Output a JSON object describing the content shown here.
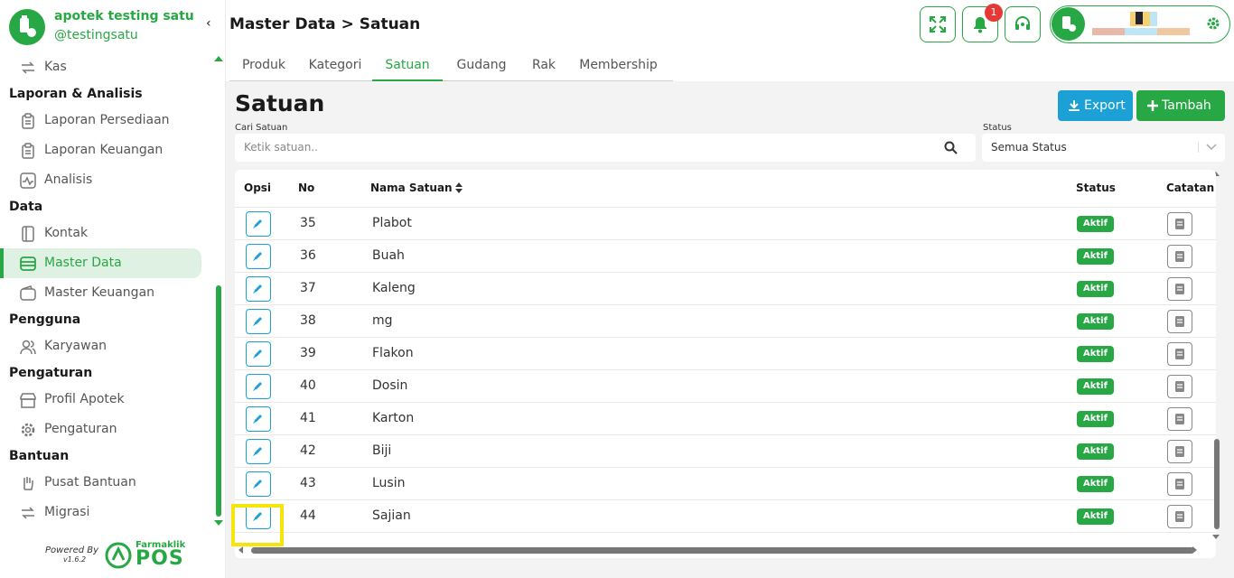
{
  "brand": {
    "name": "apotek testing satu",
    "handle": "@testingsatu",
    "color": "#27a844"
  },
  "sidebar": {
    "collapse_icon": "chevron-left-icon",
    "groups": [
      {
        "items": [
          {
            "label": "Kas",
            "icon": "cash-transfer-icon"
          }
        ]
      },
      {
        "title": "Laporan & Analisis",
        "items": [
          {
            "label": "Laporan Persediaan",
            "icon": "clipboard-icon"
          },
          {
            "label": "Laporan Keuangan",
            "icon": "clipboard-icon"
          },
          {
            "label": "Analisis",
            "icon": "activity-icon"
          }
        ]
      },
      {
        "title": "Data",
        "items": [
          {
            "label": "Kontak",
            "icon": "contact-book-icon"
          },
          {
            "label": "Master Data",
            "icon": "database-icon",
            "active": true
          },
          {
            "label": "Master Keuangan",
            "icon": "wallet-icon"
          }
        ]
      },
      {
        "title": "Pengguna",
        "items": [
          {
            "label": "Karyawan",
            "icon": "users-icon"
          }
        ]
      },
      {
        "title": "Pengaturan",
        "items": [
          {
            "label": "Profil Apotek",
            "icon": "store-icon"
          },
          {
            "label": "Pengaturan",
            "icon": "gear-icon"
          }
        ]
      },
      {
        "title": "Bantuan",
        "items": [
          {
            "label": "Pusat Bantuan",
            "icon": "hand-icon"
          },
          {
            "label": "Migrasi",
            "icon": "migrate-icon"
          }
        ]
      }
    ]
  },
  "powered": {
    "text": "Powered By",
    "version": "v1.6.2",
    "brand_top": "Farmaklik",
    "brand_bottom": "POS"
  },
  "header": {
    "title": "Master Data > Satuan",
    "notification_count": "1"
  },
  "tabs": [
    {
      "label": "Produk"
    },
    {
      "label": "Kategori"
    },
    {
      "label": "Satuan",
      "active": true
    },
    {
      "label": "Gudang"
    },
    {
      "label": "Rak"
    },
    {
      "label": "Membership"
    }
  ],
  "content": {
    "heading": "Satuan",
    "export_label": "Export",
    "add_label": "Tambah",
    "search_label": "Cari Satuan",
    "search_placeholder": "Ketik satuan..",
    "status_label": "Status",
    "status_value": "Semua Status"
  },
  "table": {
    "columns": {
      "opsi": "Opsi",
      "no": "No",
      "nama": "Nama Satuan",
      "status": "Status",
      "catatan": "Catatan"
    },
    "rows": [
      {
        "no": "35",
        "name": "Plabot",
        "status": "Aktif"
      },
      {
        "no": "36",
        "name": "Buah",
        "status": "Aktif"
      },
      {
        "no": "37",
        "name": "Kaleng",
        "status": "Aktif"
      },
      {
        "no": "38",
        "name": "mg",
        "status": "Aktif"
      },
      {
        "no": "39",
        "name": "Flakon",
        "status": "Aktif"
      },
      {
        "no": "40",
        "name": "Dosin",
        "status": "Aktif"
      },
      {
        "no": "41",
        "name": "Karton",
        "status": "Aktif"
      },
      {
        "no": "42",
        "name": "Biji",
        "status": "Aktif"
      },
      {
        "no": "43",
        "name": "Lusin",
        "status": "Aktif"
      },
      {
        "no": "44",
        "name": "Sajian",
        "status": "Aktif"
      }
    ]
  },
  "colors": {
    "accent": "#27a844",
    "info": "#1ba1d6",
    "danger": "#e53935",
    "highlight": "#f5e50a"
  }
}
